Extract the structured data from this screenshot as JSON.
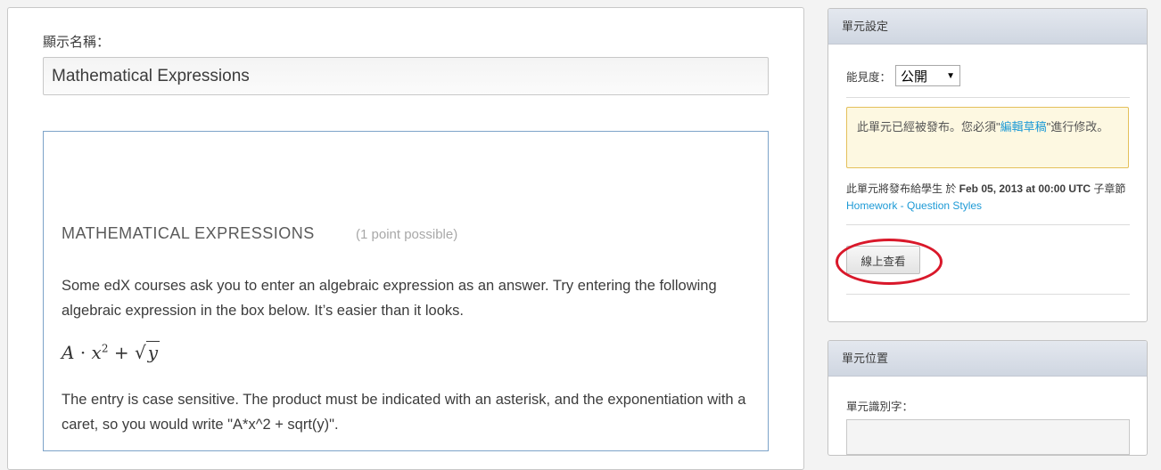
{
  "editor": {
    "display_name_label": "顯示名稱：",
    "display_name_value": "Mathematical Expressions"
  },
  "problem": {
    "title": "Mathematical Expressions",
    "points": "(1 point possible)",
    "intro": "Some edX courses ask you to enter an algebraic expression as an answer. Try entering the following algebraic expression in the box below. It’s easier than it looks.",
    "formula_A": "A",
    "formula_dot": "·",
    "formula_x": "x",
    "formula_exp": "2",
    "formula_plus": "+",
    "formula_sqrt": "√",
    "formula_y": "y",
    "instructions": "The entry is case sensitive. The product must be indicated with an asterisk, and the exponentiation with a caret, so you would write \"A*x^2 + sqrt(y)\"."
  },
  "unit_settings": {
    "header": "單元設定",
    "visibility_label": "能見度：",
    "visibility_value": "公開",
    "warning_prefix": "此單元已經被發布。您必須\"",
    "warning_link": "編輯草稿",
    "warning_suffix": "\"進行修改。",
    "release_prefix": "此單元將發布給學生 於 ",
    "release_date": "Feb 05, 2013 at 00:00 UTC",
    "release_suffix": " 子章節",
    "section_link": "Homework - Question Styles",
    "view_live_button": "線上查看"
  },
  "unit_location": {
    "header": "單元位置",
    "id_label": "單元識別字："
  },
  "colors": {
    "link": "#1d9ad6",
    "warning_bg": "#fdf8e1",
    "warning_border": "#e4c05b",
    "highlight_ring": "#d9182a"
  }
}
